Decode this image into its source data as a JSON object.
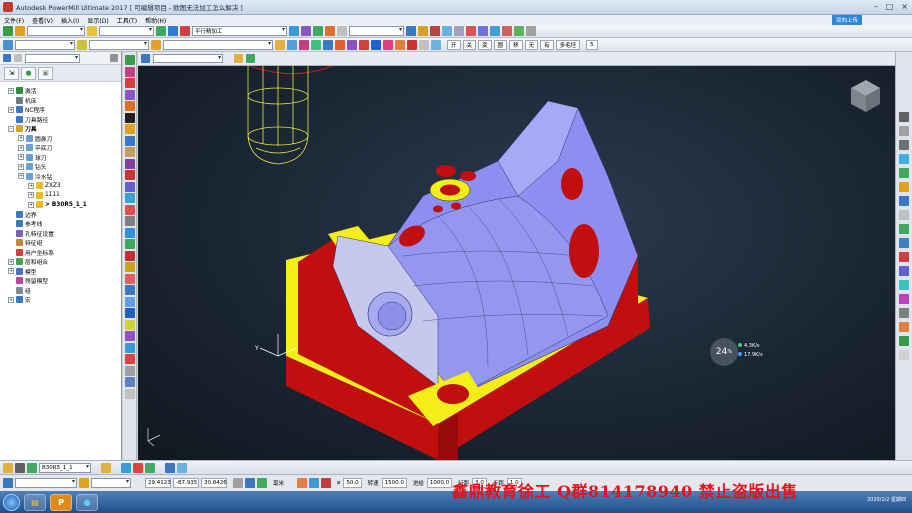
{
  "window": {
    "title": "Autodesk PowerMill Ultimate 2017   [ 可编辑项目 - 欧图无法加工怎么解决 ]",
    "upload_label": "双向上传"
  },
  "menu": [
    "文件(F)",
    "查看(V)",
    "插入(I)",
    "显示(D)",
    "工具(T)",
    "帮助(H)"
  ],
  "toolbar1": {
    "strategy_combo": "平行精加工"
  },
  "toolbar2": {
    "buttons": [
      "开",
      "关",
      "变",
      "圆",
      "移",
      "无",
      "有",
      "多毛坯"
    ],
    "number": "5"
  },
  "explorer": {
    "tree": [
      {
        "label": "激活",
        "level": 0,
        "expand": "+",
        "color": "#2e8b3e"
      },
      {
        "label": "机床",
        "level": 0,
        "expand": "",
        "color": "#6b7b8c"
      },
      {
        "label": "NC程序",
        "level": 0,
        "expand": "+",
        "color": "#3a78c2"
      },
      {
        "label": "刀具路径",
        "level": 0,
        "expand": "",
        "color": "#3a78c2"
      },
      {
        "label": "刀具",
        "level": 0,
        "expand": "-",
        "color": "#d9a520",
        "bold": true
      },
      {
        "label": "圆鼻刀",
        "level": 1,
        "expand": "+",
        "color": "#6aa0d8"
      },
      {
        "label": "平底刀",
        "level": 1,
        "expand": "+",
        "color": "#6aa0d8"
      },
      {
        "label": "球刀",
        "level": 1,
        "expand": "+",
        "color": "#6aa0d8"
      },
      {
        "label": "钻头",
        "level": 1,
        "expand": "+",
        "color": "#6aa0d8"
      },
      {
        "label": "冷水钻",
        "level": 1,
        "expand": "+",
        "color": "#6aa0d8"
      },
      {
        "label": "ZXZ3",
        "level": 2,
        "expand": "+",
        "color": "#e0c020"
      },
      {
        "label": "1111",
        "level": 2,
        "expand": "+",
        "color": "#e0c020"
      },
      {
        "label": "> B30R5_1_1",
        "level": 2,
        "expand": "+",
        "color": "#e0c020",
        "bold": true
      },
      {
        "label": "边界",
        "level": 0,
        "expand": "",
        "color": "#3a78c2"
      },
      {
        "label": "参考线",
        "level": 0,
        "expand": "",
        "color": "#3a78c2"
      },
      {
        "label": "孔特征设置",
        "level": 0,
        "expand": "",
        "color": "#7a5fc0"
      },
      {
        "label": "特征组",
        "level": 0,
        "expand": "",
        "color": "#c28a30"
      },
      {
        "label": "用户坐标系",
        "level": 0,
        "expand": "",
        "color": "#d04040"
      },
      {
        "label": "层和组合",
        "level": 0,
        "expand": "+",
        "color": "#4aa050"
      },
      {
        "label": "模型",
        "level": 0,
        "expand": "+",
        "color": "#4a70c0"
      },
      {
        "label": "残留模型",
        "level": 0,
        "expand": "",
        "color": "#c040a0"
      },
      {
        "label": "组",
        "level": 0,
        "expand": "",
        "color": "#7a8a9a"
      },
      {
        "label": "宏",
        "level": 0,
        "expand": "+",
        "color": "#3a78c2"
      }
    ]
  },
  "bottom_toolbar": {
    "tool_combo": "B30R5_1_1"
  },
  "status": {
    "x": "29.4123",
    "y": "-87.935",
    "z": "30.8426",
    "unit": "毫米",
    "tol_label": "⌀",
    "tol_value": "50.0",
    "feed_label": "转速",
    "feed_value": "1500.0",
    "cut_label": "进给",
    "cut_value": "1000.0",
    "plunge_label": "行距",
    "plunge_value": "3.0",
    "step_label": "步距",
    "step_value": "1.0"
  },
  "hud": {
    "fps": "24",
    "fps_unit": "%",
    "up": "4.3",
    "down": "17.9",
    "up_unit": "K/s"
  },
  "watermark": "鑫鼎教育徐工 Q群814178940 禁止盗版出售",
  "clock": {
    "date": "2020/1/2 星期四"
  },
  "taskbar": {
    "p_label": "P"
  },
  "colors": {
    "part_blue": "#8c8ff0",
    "part_red": "#c10e0e",
    "part_yellow": "#f4ee18",
    "tool_wire": "#e8e846",
    "watermark": "#e8101a"
  }
}
